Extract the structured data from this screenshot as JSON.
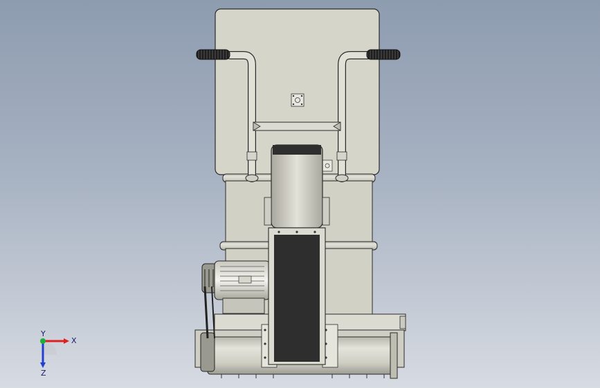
{
  "viewport": {
    "background_top": "#8e9cb0",
    "background_bottom": "#d7dbe2",
    "body_color": "#d4d3c8",
    "edge_color": "#2a2a2a",
    "dark_color": "#2e2e2e"
  },
  "triad": {
    "x_label": "X",
    "y_label": "Y",
    "z_label": "Z",
    "x_color": "#e02020",
    "y_color": "#1fae3a",
    "z_color": "#2040d0"
  }
}
